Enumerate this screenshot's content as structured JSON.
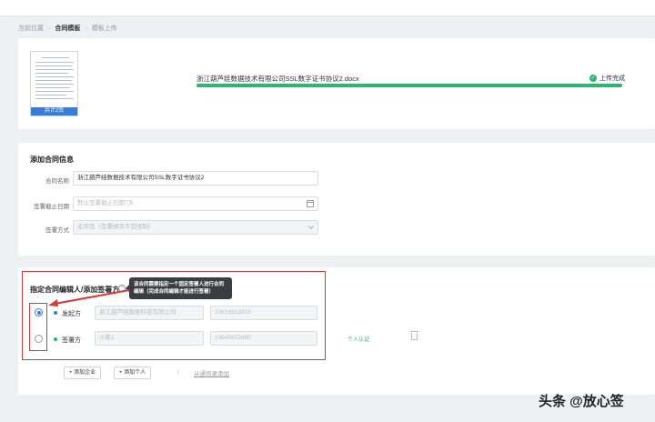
{
  "breadcrumb": {
    "location_label": "当前位置",
    "current": "合同模板",
    "next": "模板上传"
  },
  "upload": {
    "thumb_caption": "共计2页",
    "file_name": "浙江葫芦娃数据技术有限公司SSL数字证书协议2.docx",
    "progress_fraction": 1.0,
    "status": "上传完成",
    "status_icon": "check-circle-icon"
  },
  "contract_info": {
    "title": "添加合同信息",
    "name_label": "合同名称",
    "name_value": "浙江葫芦娃数据技术有限公司SSL数字证书协议2",
    "deadline_label": "签署截止日期",
    "deadline_placeholder": "默认签署截止日期7天",
    "method_label": "签署方式",
    "method_value": "无序签（签署顺序不受限制）"
  },
  "signers": {
    "title": "指定合同编辑人/添加签署方",
    "tooltip": "该合同需要指定一个固定签署人进行合同编辑（完成合同编辑才能进行签署）",
    "rows": [
      {
        "role": "发起方",
        "company": "浙江葫芦娃数据科技有限公司",
        "phone": "13616513913",
        "dot_color": "#3a7bd5",
        "selected": true
      },
      {
        "role": "签署方",
        "company": "小陈1",
        "phone": "13640872880",
        "dot_color": "#2bb673",
        "selected": false,
        "tag": "个人认证"
      }
    ],
    "add_company": "+ 添加企业",
    "add_person": "+ 添加个人",
    "divider": "/",
    "address_book": "从通讯录添加"
  },
  "watermark": "头条 @放心签",
  "colors": {
    "accent": "#3a7bd5",
    "success": "#2bb673",
    "highlight": "#d9383a"
  }
}
